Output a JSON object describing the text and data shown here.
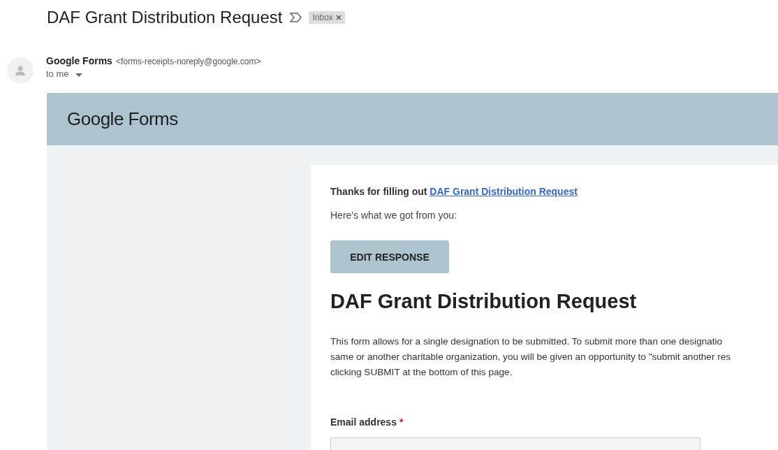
{
  "subject": "DAF Grant Distribution Request",
  "label": "Inbox",
  "sender": {
    "name": "Google Forms",
    "address": "<forms-receipts-noreply@google.com>",
    "recipient": "to me"
  },
  "banner": {
    "logo_word_1": "Google",
    "logo_word_2": "Forms"
  },
  "card": {
    "thanks": "Thanks for filling out",
    "form_link": "DAF Grant Distribution Request",
    "intro": "Here's what we got from you:",
    "button": "EDIT RESPONSE",
    "title": "DAF Grant Distribution Request",
    "description_lines": [
      "This form allows for a single designation to be submitted. To submit more than one designatio",
      "same or another charitable organization, you will be given an opportunity to \"submit another res",
      "clicking SUBMIT at the bottom of this page."
    ],
    "question": {
      "label": "Email address",
      "required": true,
      "required_mark": "*"
    }
  }
}
